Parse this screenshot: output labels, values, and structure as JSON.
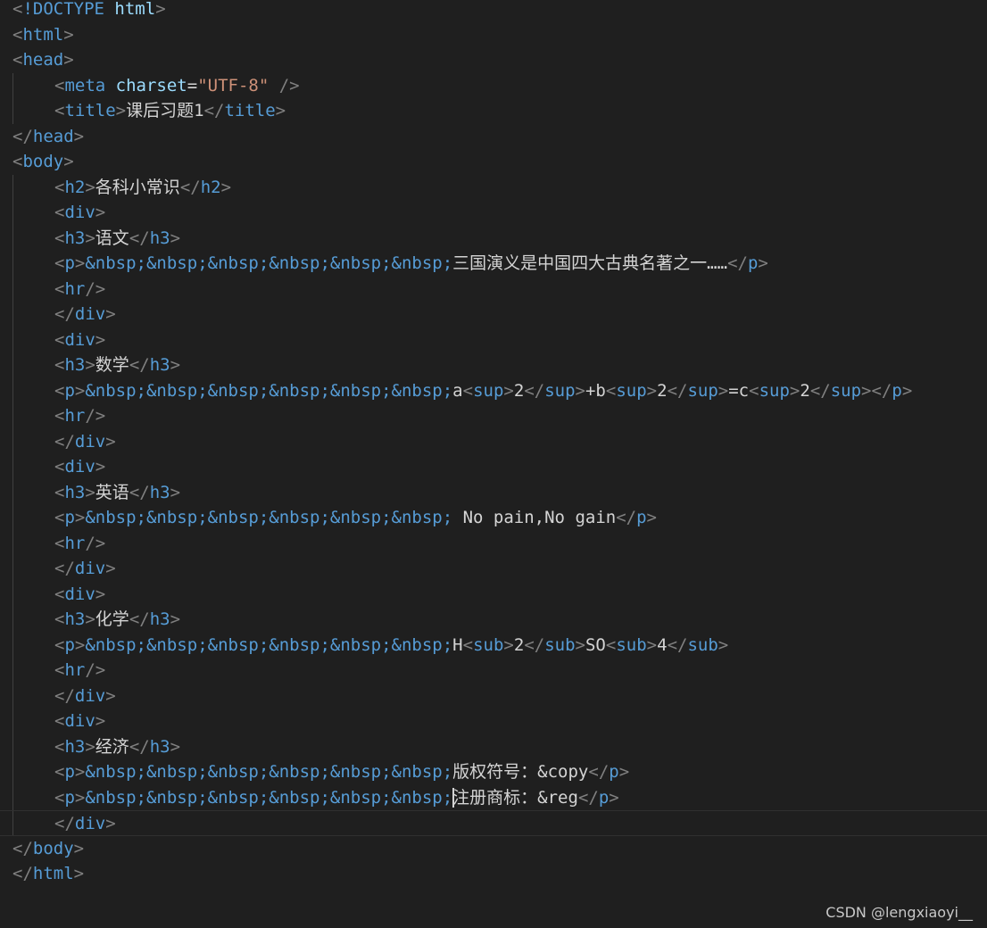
{
  "editor": {
    "language": "html",
    "current_line": 32,
    "lines": [
      {
        "indent": 0,
        "tokens": [
          {
            "t": "br",
            "v": "<"
          },
          {
            "t": "tag",
            "v": "!DOCTYPE"
          },
          {
            "t": "text",
            "v": " "
          },
          {
            "t": "attr",
            "v": "html"
          },
          {
            "t": "br",
            "v": ">"
          }
        ]
      },
      {
        "indent": 0,
        "tokens": [
          {
            "t": "br",
            "v": "<"
          },
          {
            "t": "tag",
            "v": "html"
          },
          {
            "t": "br",
            "v": ">"
          }
        ]
      },
      {
        "indent": 0,
        "tokens": [
          {
            "t": "br",
            "v": "<"
          },
          {
            "t": "tag",
            "v": "head"
          },
          {
            "t": "br",
            "v": ">"
          }
        ]
      },
      {
        "indent": 1,
        "tokens": [
          {
            "t": "br",
            "v": "<"
          },
          {
            "t": "tag",
            "v": "meta"
          },
          {
            "t": "text",
            "v": " "
          },
          {
            "t": "attr",
            "v": "charset"
          },
          {
            "t": "text",
            "v": "="
          },
          {
            "t": "str",
            "v": "\"UTF-8\""
          },
          {
            "t": "text",
            "v": " "
          },
          {
            "t": "br",
            "v": "/>"
          }
        ]
      },
      {
        "indent": 1,
        "tokens": [
          {
            "t": "br",
            "v": "<"
          },
          {
            "t": "tag",
            "v": "title"
          },
          {
            "t": "br",
            "v": ">"
          },
          {
            "t": "text",
            "v": "课后习题1"
          },
          {
            "t": "br",
            "v": "</"
          },
          {
            "t": "tag",
            "v": "title"
          },
          {
            "t": "br",
            "v": ">"
          }
        ]
      },
      {
        "indent": 0,
        "tokens": [
          {
            "t": "br",
            "v": "</"
          },
          {
            "t": "tag",
            "v": "head"
          },
          {
            "t": "br",
            "v": ">"
          }
        ]
      },
      {
        "indent": 0,
        "tokens": [
          {
            "t": "br",
            "v": "<"
          },
          {
            "t": "tag",
            "v": "body"
          },
          {
            "t": "br",
            "v": ">"
          }
        ]
      },
      {
        "indent": 1,
        "tokens": [
          {
            "t": "br",
            "v": "<"
          },
          {
            "t": "tag",
            "v": "h2"
          },
          {
            "t": "br",
            "v": ">"
          },
          {
            "t": "text",
            "v": "各科小常识"
          },
          {
            "t": "br",
            "v": "</"
          },
          {
            "t": "tag",
            "v": "h2"
          },
          {
            "t": "br",
            "v": ">"
          }
        ]
      },
      {
        "indent": 1,
        "tokens": [
          {
            "t": "br",
            "v": "<"
          },
          {
            "t": "tag",
            "v": "div"
          },
          {
            "t": "br",
            "v": ">"
          }
        ]
      },
      {
        "indent": 1,
        "tokens": [
          {
            "t": "br",
            "v": "<"
          },
          {
            "t": "tag",
            "v": "h3"
          },
          {
            "t": "br",
            "v": ">"
          },
          {
            "t": "text",
            "v": "语文"
          },
          {
            "t": "br",
            "v": "</"
          },
          {
            "t": "tag",
            "v": "h3"
          },
          {
            "t": "br",
            "v": ">"
          }
        ]
      },
      {
        "indent": 1,
        "tokens": [
          {
            "t": "br",
            "v": "<"
          },
          {
            "t": "tag",
            "v": "p"
          },
          {
            "t": "br",
            "v": ">"
          },
          {
            "t": "ent",
            "v": "&nbsp;&nbsp;&nbsp;&nbsp;&nbsp;&nbsp;"
          },
          {
            "t": "text",
            "v": "三国演义是中国四大古典名著之一……"
          },
          {
            "t": "br",
            "v": "</"
          },
          {
            "t": "tag",
            "v": "p"
          },
          {
            "t": "br",
            "v": ">"
          }
        ]
      },
      {
        "indent": 1,
        "tokens": [
          {
            "t": "br",
            "v": "<"
          },
          {
            "t": "tag",
            "v": "hr"
          },
          {
            "t": "br",
            "v": "/>"
          }
        ]
      },
      {
        "indent": 1,
        "tokens": [
          {
            "t": "br",
            "v": "</"
          },
          {
            "t": "tag",
            "v": "div"
          },
          {
            "t": "br",
            "v": ">"
          }
        ]
      },
      {
        "indent": 1,
        "tokens": [
          {
            "t": "br",
            "v": "<"
          },
          {
            "t": "tag",
            "v": "div"
          },
          {
            "t": "br",
            "v": ">"
          }
        ]
      },
      {
        "indent": 1,
        "tokens": [
          {
            "t": "br",
            "v": "<"
          },
          {
            "t": "tag",
            "v": "h3"
          },
          {
            "t": "br",
            "v": ">"
          },
          {
            "t": "text",
            "v": "数学"
          },
          {
            "t": "br",
            "v": "</"
          },
          {
            "t": "tag",
            "v": "h3"
          },
          {
            "t": "br",
            "v": ">"
          }
        ]
      },
      {
        "indent": 1,
        "tokens": [
          {
            "t": "br",
            "v": "<"
          },
          {
            "t": "tag",
            "v": "p"
          },
          {
            "t": "br",
            "v": ">"
          },
          {
            "t": "ent",
            "v": "&nbsp;&nbsp;&nbsp;&nbsp;&nbsp;&nbsp;"
          },
          {
            "t": "text",
            "v": "a"
          },
          {
            "t": "br",
            "v": "<"
          },
          {
            "t": "tag",
            "v": "sup"
          },
          {
            "t": "br",
            "v": ">"
          },
          {
            "t": "text",
            "v": "2"
          },
          {
            "t": "br",
            "v": "</"
          },
          {
            "t": "tag",
            "v": "sup"
          },
          {
            "t": "br",
            "v": ">"
          },
          {
            "t": "text",
            "v": "+b"
          },
          {
            "t": "br",
            "v": "<"
          },
          {
            "t": "tag",
            "v": "sup"
          },
          {
            "t": "br",
            "v": ">"
          },
          {
            "t": "text",
            "v": "2"
          },
          {
            "t": "br",
            "v": "</"
          },
          {
            "t": "tag",
            "v": "sup"
          },
          {
            "t": "br",
            "v": ">"
          },
          {
            "t": "text",
            "v": "=c"
          },
          {
            "t": "br",
            "v": "<"
          },
          {
            "t": "tag",
            "v": "sup"
          },
          {
            "t": "br",
            "v": ">"
          },
          {
            "t": "text",
            "v": "2"
          },
          {
            "t": "br",
            "v": "</"
          },
          {
            "t": "tag",
            "v": "sup"
          },
          {
            "t": "br",
            "v": ">"
          },
          {
            "t": "br",
            "v": "</"
          },
          {
            "t": "tag",
            "v": "p"
          },
          {
            "t": "br",
            "v": ">"
          }
        ]
      },
      {
        "indent": 1,
        "tokens": [
          {
            "t": "br",
            "v": "<"
          },
          {
            "t": "tag",
            "v": "hr"
          },
          {
            "t": "br",
            "v": "/>"
          }
        ]
      },
      {
        "indent": 1,
        "tokens": [
          {
            "t": "br",
            "v": "</"
          },
          {
            "t": "tag",
            "v": "div"
          },
          {
            "t": "br",
            "v": ">"
          }
        ]
      },
      {
        "indent": 1,
        "tokens": [
          {
            "t": "br",
            "v": "<"
          },
          {
            "t": "tag",
            "v": "div"
          },
          {
            "t": "br",
            "v": ">"
          }
        ]
      },
      {
        "indent": 1,
        "tokens": [
          {
            "t": "br",
            "v": "<"
          },
          {
            "t": "tag",
            "v": "h3"
          },
          {
            "t": "br",
            "v": ">"
          },
          {
            "t": "text",
            "v": "英语"
          },
          {
            "t": "br",
            "v": "</"
          },
          {
            "t": "tag",
            "v": "h3"
          },
          {
            "t": "br",
            "v": ">"
          }
        ]
      },
      {
        "indent": 1,
        "tokens": [
          {
            "t": "br",
            "v": "<"
          },
          {
            "t": "tag",
            "v": "p"
          },
          {
            "t": "br",
            "v": ">"
          },
          {
            "t": "ent",
            "v": "&nbsp;&nbsp;&nbsp;&nbsp;&nbsp;&nbsp;"
          },
          {
            "t": "text",
            "v": " No pain,No gain"
          },
          {
            "t": "br",
            "v": "</"
          },
          {
            "t": "tag",
            "v": "p"
          },
          {
            "t": "br",
            "v": ">"
          }
        ]
      },
      {
        "indent": 1,
        "tokens": [
          {
            "t": "br",
            "v": "<"
          },
          {
            "t": "tag",
            "v": "hr"
          },
          {
            "t": "br",
            "v": "/>"
          }
        ]
      },
      {
        "indent": 1,
        "tokens": [
          {
            "t": "br",
            "v": "</"
          },
          {
            "t": "tag",
            "v": "div"
          },
          {
            "t": "br",
            "v": ">"
          }
        ]
      },
      {
        "indent": 1,
        "tokens": [
          {
            "t": "br",
            "v": "<"
          },
          {
            "t": "tag",
            "v": "div"
          },
          {
            "t": "br",
            "v": ">"
          }
        ]
      },
      {
        "indent": 1,
        "tokens": [
          {
            "t": "br",
            "v": "<"
          },
          {
            "t": "tag",
            "v": "h3"
          },
          {
            "t": "br",
            "v": ">"
          },
          {
            "t": "text",
            "v": "化学"
          },
          {
            "t": "br",
            "v": "</"
          },
          {
            "t": "tag",
            "v": "h3"
          },
          {
            "t": "br",
            "v": ">"
          }
        ]
      },
      {
        "indent": 1,
        "tokens": [
          {
            "t": "br",
            "v": "<"
          },
          {
            "t": "tag",
            "v": "p"
          },
          {
            "t": "br",
            "v": ">"
          },
          {
            "t": "ent",
            "v": "&nbsp;&nbsp;&nbsp;&nbsp;&nbsp;&nbsp;"
          },
          {
            "t": "text",
            "v": "H"
          },
          {
            "t": "br",
            "v": "<"
          },
          {
            "t": "tag",
            "v": "sub"
          },
          {
            "t": "br",
            "v": ">"
          },
          {
            "t": "text",
            "v": "2"
          },
          {
            "t": "br",
            "v": "</"
          },
          {
            "t": "tag",
            "v": "sub"
          },
          {
            "t": "br",
            "v": ">"
          },
          {
            "t": "text",
            "v": "SO"
          },
          {
            "t": "br",
            "v": "<"
          },
          {
            "t": "tag",
            "v": "sub"
          },
          {
            "t": "br",
            "v": ">"
          },
          {
            "t": "text",
            "v": "4"
          },
          {
            "t": "br",
            "v": "</"
          },
          {
            "t": "tag",
            "v": "sub"
          },
          {
            "t": "br",
            "v": ">"
          }
        ]
      },
      {
        "indent": 1,
        "tokens": [
          {
            "t": "br",
            "v": "<"
          },
          {
            "t": "tag",
            "v": "hr"
          },
          {
            "t": "br",
            "v": "/>"
          }
        ]
      },
      {
        "indent": 1,
        "tokens": [
          {
            "t": "br",
            "v": "</"
          },
          {
            "t": "tag",
            "v": "div"
          },
          {
            "t": "br",
            "v": ">"
          }
        ]
      },
      {
        "indent": 1,
        "tokens": [
          {
            "t": "br",
            "v": "<"
          },
          {
            "t": "tag",
            "v": "div"
          },
          {
            "t": "br",
            "v": ">"
          }
        ]
      },
      {
        "indent": 1,
        "tokens": [
          {
            "t": "br",
            "v": "<"
          },
          {
            "t": "tag",
            "v": "h3"
          },
          {
            "t": "br",
            "v": ">"
          },
          {
            "t": "text",
            "v": "经济"
          },
          {
            "t": "br",
            "v": "</"
          },
          {
            "t": "tag",
            "v": "h3"
          },
          {
            "t": "br",
            "v": ">"
          }
        ]
      },
      {
        "indent": 1,
        "tokens": [
          {
            "t": "br",
            "v": "<"
          },
          {
            "t": "tag",
            "v": "p"
          },
          {
            "t": "br",
            "v": ">"
          },
          {
            "t": "ent",
            "v": "&nbsp;&nbsp;&nbsp;&nbsp;&nbsp;&nbsp;"
          },
          {
            "t": "text",
            "v": "版权符号：&copy"
          },
          {
            "t": "br",
            "v": "</"
          },
          {
            "t": "tag",
            "v": "p"
          },
          {
            "t": "br",
            "v": ">"
          }
        ]
      },
      {
        "indent": 1,
        "tokens": [
          {
            "t": "br",
            "v": "<"
          },
          {
            "t": "tag",
            "v": "p"
          },
          {
            "t": "br",
            "v": ">"
          },
          {
            "t": "ent",
            "v": "&nbsp;&nbsp;&nbsp;&nbsp;&nbsp;&nbsp;"
          },
          {
            "t": "cursor",
            "v": ""
          },
          {
            "t": "text",
            "v": "注册商标：&reg"
          },
          {
            "t": "br",
            "v": "</"
          },
          {
            "t": "tag",
            "v": "p"
          },
          {
            "t": "br",
            "v": ">"
          }
        ]
      },
      {
        "indent": 1,
        "tokens": [
          {
            "t": "br",
            "v": "</"
          },
          {
            "t": "tag",
            "v": "div"
          },
          {
            "t": "br",
            "v": ">"
          }
        ]
      },
      {
        "indent": 0,
        "tokens": [
          {
            "t": "br",
            "v": "</"
          },
          {
            "t": "tag",
            "v": "body"
          },
          {
            "t": "br",
            "v": ">"
          }
        ]
      },
      {
        "indent": 0,
        "tokens": [
          {
            "t": "br",
            "v": "</"
          },
          {
            "t": "tag",
            "v": "html"
          },
          {
            "t": "br",
            "v": ">"
          }
        ]
      }
    ]
  },
  "watermark": "CSDN @lengxiaoyi__"
}
